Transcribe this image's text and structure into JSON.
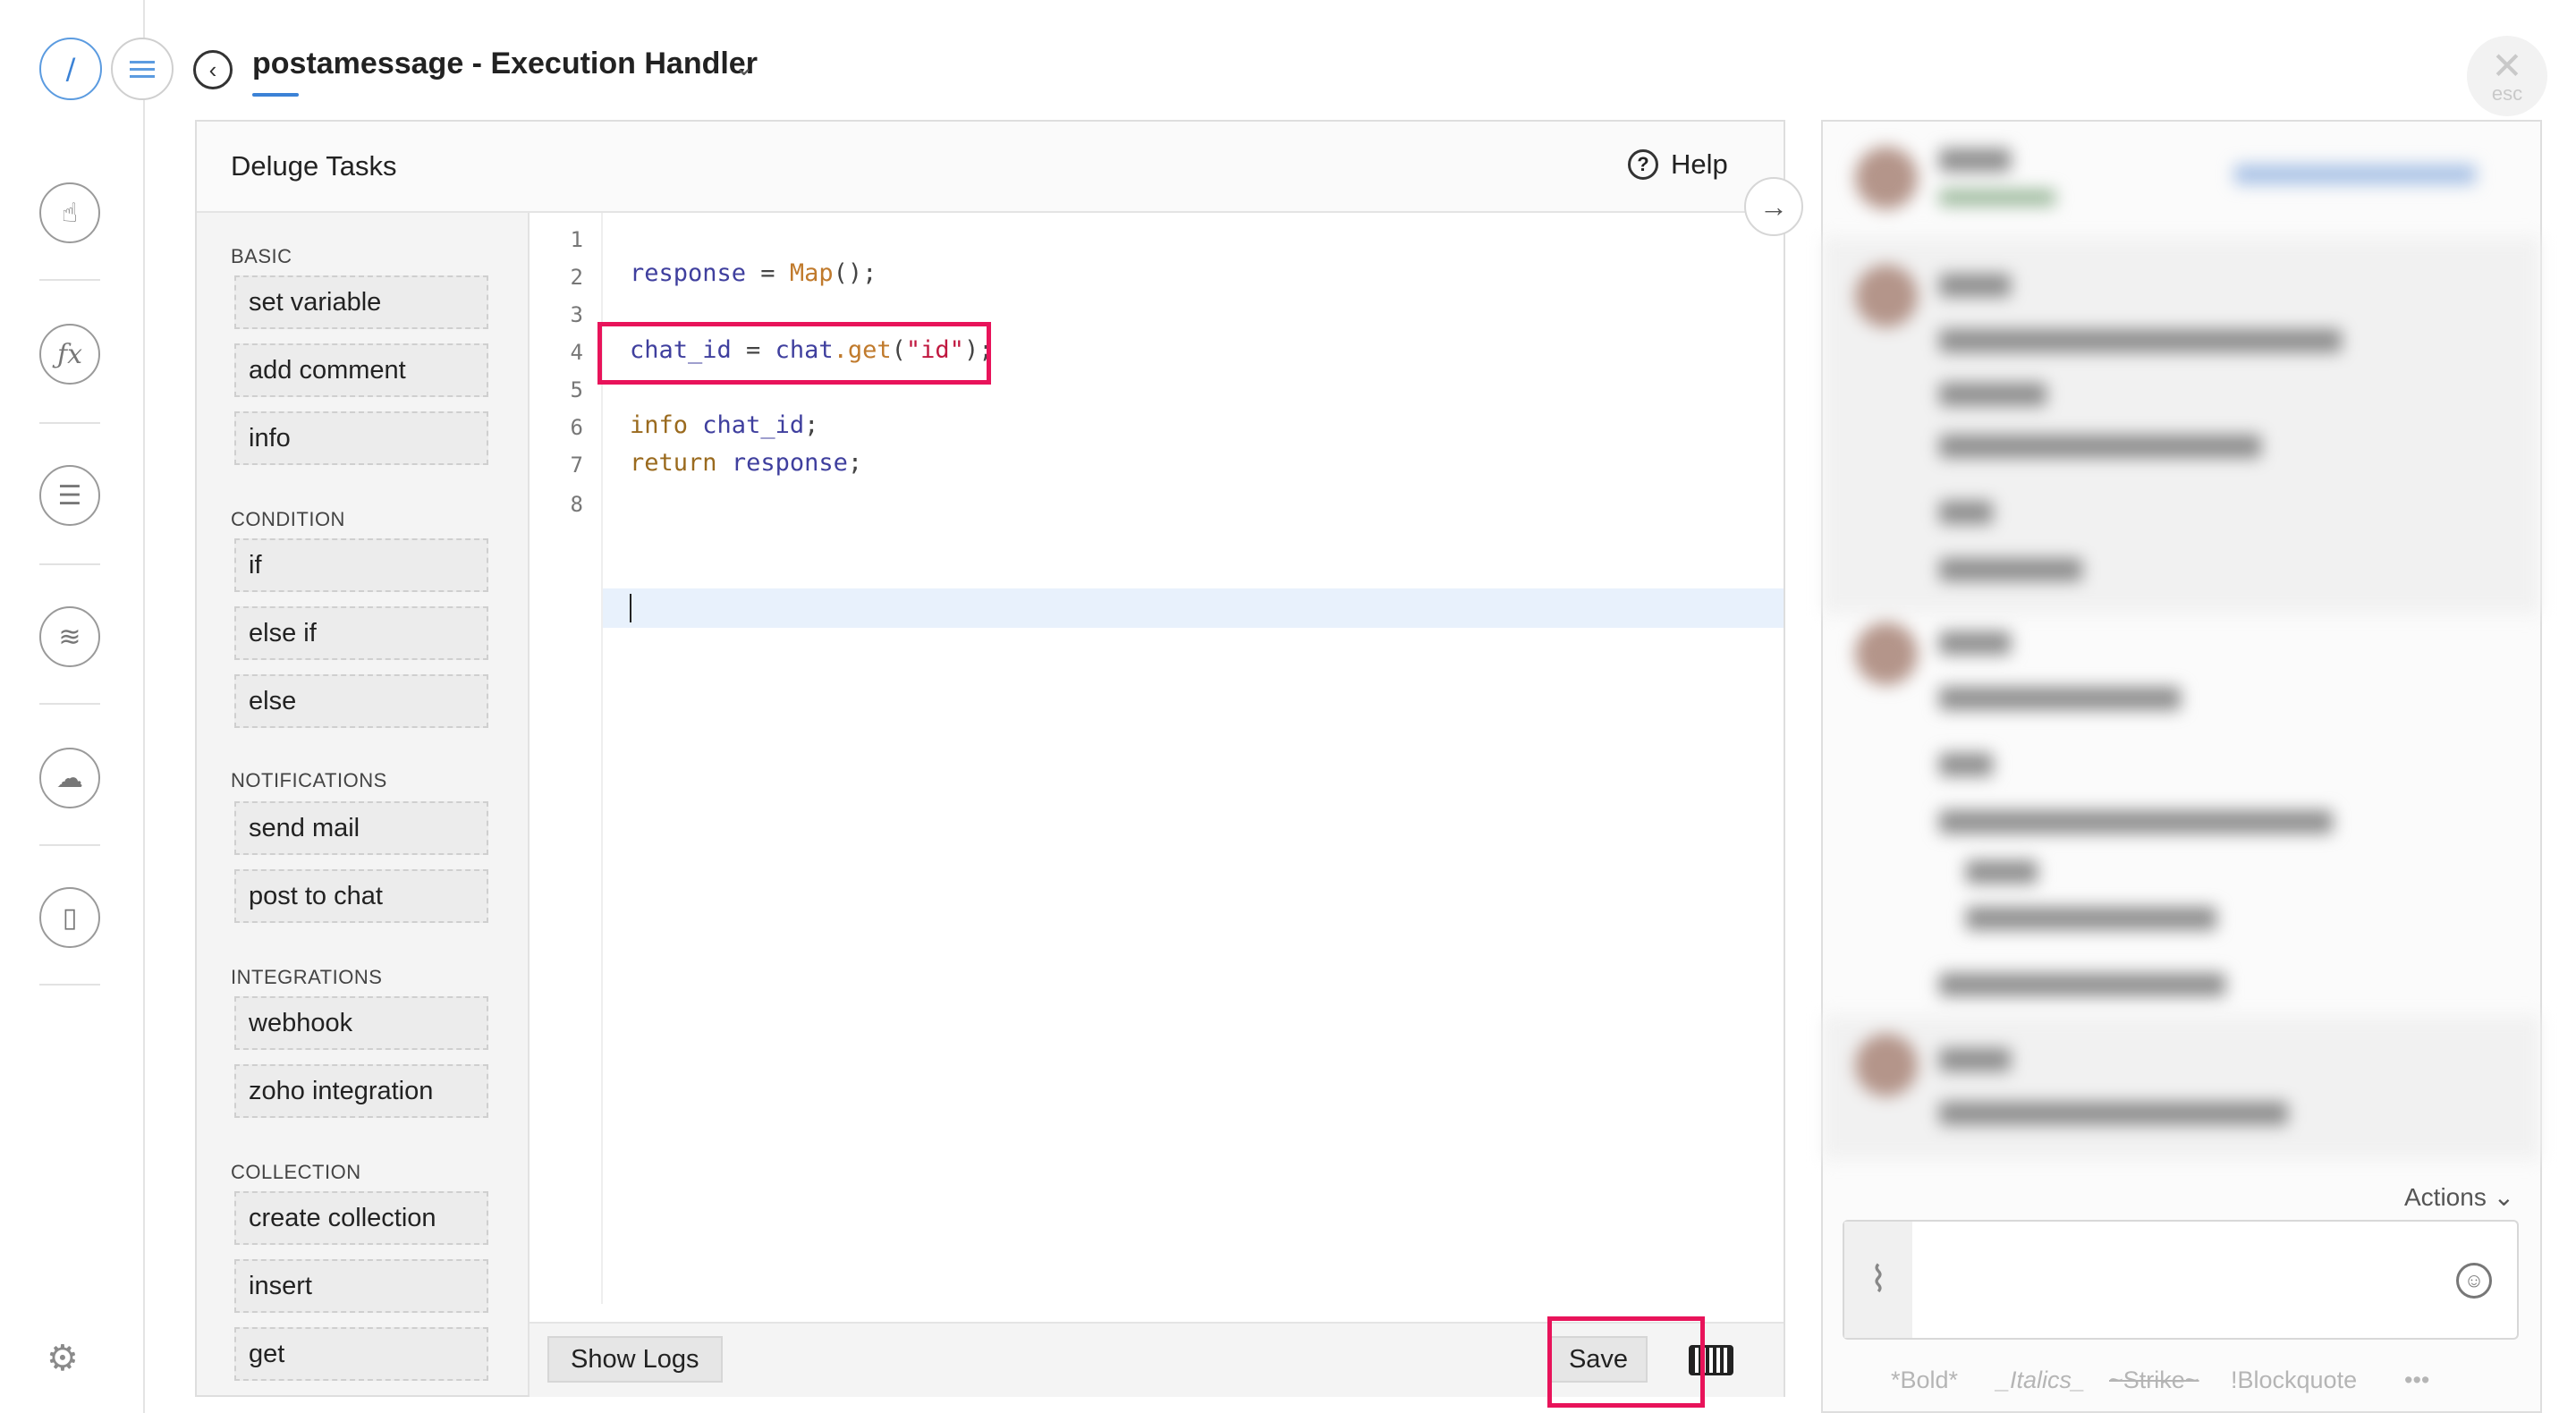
{
  "header": {
    "rail_slash": "/",
    "title": "postamessage  -  Execution Handler",
    "close_label": "esc"
  },
  "panel": {
    "title": "Deluge Tasks",
    "help_label": "Help"
  },
  "tasks": {
    "sections": [
      {
        "label": "BASIC",
        "items": [
          "set variable",
          "add comment",
          "info"
        ]
      },
      {
        "label": "CONDITION",
        "items": [
          "if",
          "else if",
          "else"
        ]
      },
      {
        "label": "NOTIFICATIONS",
        "items": [
          "send mail",
          "post to chat"
        ]
      },
      {
        "label": "INTEGRATIONS",
        "items": [
          "webhook",
          "zoho integration"
        ]
      },
      {
        "label": "COLLECTION",
        "items": [
          "create collection",
          "insert",
          "get"
        ]
      }
    ]
  },
  "editor": {
    "line_numbers": [
      "1",
      "2",
      "3",
      "4",
      "5",
      "6",
      "7",
      "8"
    ],
    "line2": {
      "var": "response",
      "op": " = ",
      "fn": "Map",
      "end": "();"
    },
    "line4": {
      "var1": "chat_id",
      "op": " = ",
      "var2": "chat",
      "fn": ".get",
      "open": "(",
      "str": "\"id\"",
      "end": ");"
    },
    "line6": {
      "kw": "info",
      "sp": " ",
      "var": "chat_id",
      "end": ";"
    },
    "line7": {
      "kw": "return",
      "sp": " ",
      "var": "response",
      "end": ";"
    }
  },
  "footer": {
    "show_logs": "Show Logs",
    "save": "Save"
  },
  "chat": {
    "actions_label": "Actions",
    "format_hints": [
      "*Bold*",
      "_Italics_",
      "~Strike~",
      "!Blockquote",
      "•••"
    ]
  }
}
